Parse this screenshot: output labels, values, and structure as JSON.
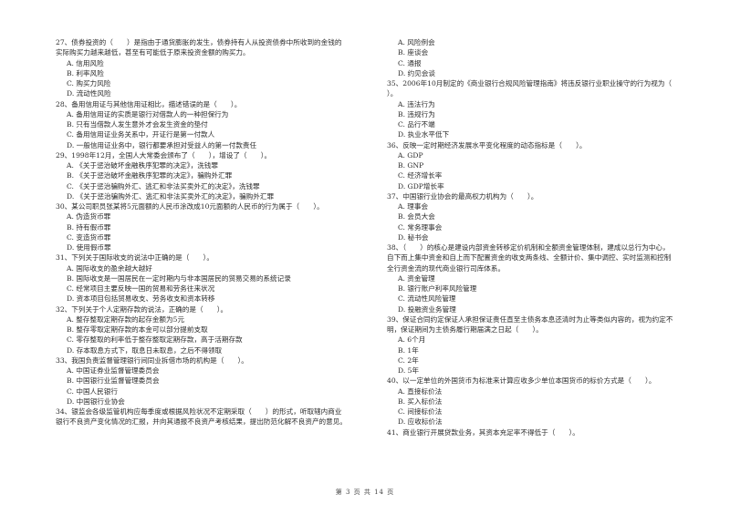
{
  "left_column": [
    {
      "number": "27、",
      "stem": "债券投资的（　　）是指由于通货膨胀的发生，债券持有人从投资债券中所收到的金钱的实际购买力越来越低，甚至有可能低于原来投资金额的购买力。",
      "stem_lines": [
        "27、债券投资的（　　）是指由于通货膨胀的发生，债券持有人从投资债券中所收到的金钱的",
        "实际购买力越来越低，甚至有可能低于原来投资金额的购买力。"
      ],
      "options": [
        "A. 信用风险",
        "B. 利率风险",
        "C. 购买力风险",
        "D. 流动性风险"
      ]
    },
    {
      "stem_lines": [
        "28、备用信用证与其他信用证相比，描述错误的是（　　）。"
      ],
      "options": [
        "A. 备用信用证的实质是银行对借款人的一种担保行为",
        "B. 只有当借款人发生意外才会发生资金的垫付",
        "C. 备用信用证业务关系中，开证行是第一付款人",
        "D. 一般信用证业务中，银行都要承担对受益人的第一付款责任"
      ]
    },
    {
      "stem_lines": [
        "29、1998年12月，全国人大常委会颁布了（　　），增设了（　　）。"
      ],
      "options": [
        "A. 《关于惩治破坏金融秩序犯罪的决定》，洗钱罪",
        "B. 《关于惩治破坏金融秩序犯罪的决定》，骗购外汇罪",
        "C. 《关于惩治骗购外汇、逃汇和非法买卖外汇的决定》，洗钱罪",
        "D. 《关于惩治骗购外汇、逃汇和非法买卖外汇的决定》，骗购外汇罪"
      ]
    },
    {
      "stem_lines": [
        "30、某公司职员张某将5元面额的人民币涂改成10元面额的人民币的行为属于（　　）。"
      ],
      "options": [
        "A. 伪造货币罪",
        "B. 持有假币罪",
        "C. 变造货币罪",
        "D. 使用假币罪"
      ]
    },
    {
      "stem_lines": [
        "31、下列关于国际收支的说法中正确的是（　　）。"
      ],
      "options": [
        "A. 国际收支的盈余越大越好",
        "B. 国际收支是一国居民在一定时期内与非本国居民的贸易交易的系统记录",
        "C. 经常项目主要反映一国的贸易和劳务往来状况",
        "D. 资本项目包括贸易收支、劳务收支和资本转移"
      ]
    },
    {
      "stem_lines": [
        "32、下列关于个人定期存款的说法，正确的是（　　）。"
      ],
      "options": [
        "A. 整存整取定期存款的起存金额为5元",
        "B. 整存零取定期存款的本金可以部分提前支取",
        "C. 零存整取的利率低于整存整取定期存款，高于活期存款",
        "D. 存本取息方式下，取息日未取息，之后不得领取"
      ]
    },
    {
      "stem_lines": [
        "33、我国负责监督管理银行间同业拆借市场的机构是（　　）。"
      ],
      "options": [
        "A. 中国证券业监督管理委员会",
        "B. 中国银行业监督管理委员会",
        "C. 中国人民银行",
        "D. 中国银行业协会"
      ]
    },
    {
      "stem_lines": [
        "34、银监会各级监管机构应每季度或根据风险状况不定期采取（　　）的形式，听取辖内商业",
        "银行不良资产变化情况的汇报，并向其通报不良资产考核结果，提出防范化解不良资产的意见。"
      ],
      "options": []
    }
  ],
  "right_column": [
    {
      "stem_lines": [],
      "options": [
        "A. 风险例会",
        "B. 座谈会",
        "C. 通报",
        "D. 约见会谈"
      ]
    },
    {
      "stem_lines": [
        "35、2006年10月制定的《商业银行合规风险管理指南》将违反银行业职业操守的行为视为（",
        "）。"
      ],
      "options": [
        "A. 违法行为",
        "B. 违规行为",
        "C. 品行不端",
        "D. 执业水平低下"
      ]
    },
    {
      "stem_lines": [
        "36、反映一定时期经济发展水平变化程度的动态指标是（　　）。"
      ],
      "options": [
        "A. GDP",
        "B. GNP",
        "C. 经济增长率",
        "D. GDP增长率"
      ]
    },
    {
      "stem_lines": [
        "37、中国银行业协会的最高权力机构为（　　）。"
      ],
      "options": [
        "A. 理事会",
        "B. 会员大会",
        "C. 常务理事会",
        "D. 秘书会"
      ]
    },
    {
      "stem_lines": [
        "38、（　　）的核心是建设内部资金转移定价机制和全额资金管理体制，建成以总行为中心，",
        "自下而上集中资金和自上而下配置资金的收支两条线、全额计价、集中调控、实时监测和控制",
        "全行资金流的现代商业银行司库体系。"
      ],
      "options": [
        "A. 资金管理",
        "B. 银行账户利率风险管理",
        "C. 流动性风险管理",
        "D. 投融资业务管理"
      ]
    },
    {
      "stem_lines": [
        "39、保证合同约定保证人承担保证责任直至主债务本息还清时为止等类似内容的，视为约定不",
        "明，保证期间为主债务履行期届满之日起（　　）。"
      ],
      "options": [
        "A. 6个月",
        "B. 1年",
        "C. 2年",
        "D. 5年"
      ]
    },
    {
      "stem_lines": [
        "40、以一定单位的外国货币为标准来计算应收多少单位本国货币的标价方式是（　　）。"
      ],
      "options": [
        "A. 直接标价法",
        "B. 买入标价法",
        "C. 间接标价法",
        "D. 应收标价法"
      ]
    },
    {
      "stem_lines": [
        "41、商业银行开展贷款业务，其资本充足率不得低于（　　）。"
      ],
      "options": []
    }
  ],
  "footer": {
    "page_label": "第 3 页 共 14 页"
  }
}
